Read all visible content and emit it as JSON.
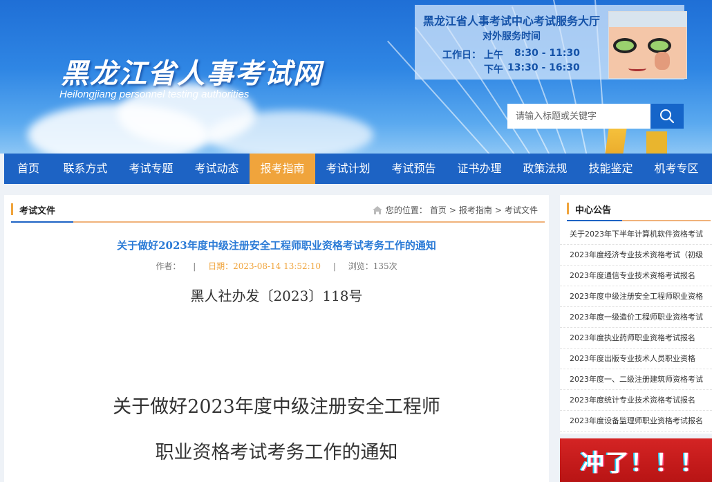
{
  "header": {
    "site_title": "黑龙江省人事考试网",
    "site_subtitle": "Heilongjiang personnel testing authorities",
    "service": {
      "title": "黑龙江省人事考试中心考试服务大厅",
      "subtitle": "对外服务时间",
      "workday_label": "工作日：",
      "morning_label": "上午",
      "morning_time": "8:30 - 11:30",
      "afternoon_label": "下午",
      "afternoon_time": "13:30 - 16:30"
    },
    "search": {
      "placeholder": "请输入标题或关键字",
      "icon": "search-icon"
    }
  },
  "nav": {
    "items": [
      {
        "label": "首页"
      },
      {
        "label": "联系方式"
      },
      {
        "label": "考试专题"
      },
      {
        "label": "考试动态"
      },
      {
        "label": "报考指南",
        "active": true
      },
      {
        "label": "考试计划"
      },
      {
        "label": "考试预告"
      },
      {
        "label": "证书办理"
      },
      {
        "label": "政策法规"
      },
      {
        "label": "技能鉴定"
      },
      {
        "label": "机考专区"
      }
    ]
  },
  "main": {
    "section_title": "考试文件",
    "breadcrumb": {
      "prefix": "您的位置：",
      "home": "首页",
      "sep": ">",
      "guide": "报考指南",
      "current": "考试文件"
    },
    "article": {
      "title": "关于做好2023年度中级注册安全工程师职业资格考试考务工作的通知",
      "author_label": "作者：",
      "sep": "|",
      "date": "日期：2023-08-14 13:52:10",
      "views": "浏览：135次",
      "doc_number": "黑人社办发〔2023〕118号",
      "heading_line1": "关于做好2023年度中级注册安全工程师",
      "heading_line2": "职业资格考试考务工作的通知"
    }
  },
  "sidebar": {
    "title": "中心公告",
    "notices": [
      "关于2023年下半年计算机软件资格考试",
      "2023年度经济专业技术资格考试（初级",
      "2023年度通信专业技术资格考试报名",
      "2023年度中级注册安全工程师职业资格",
      "2023年度一级造价工程师职业资格考试",
      "2023年度执业药师职业资格考试报名",
      "2023年度出版专业技术人员职业资格",
      "2023年度一、二级注册建筑师资格考试",
      "2023年度统计专业技术资格考试报名",
      "2023年度设备监理师职业资格考试报名"
    ],
    "promo_text": "冲了！！！"
  },
  "colors": {
    "nav_bg": "#1d63c4",
    "nav_active": "#f0a43c",
    "article_title": "#2a7ad6",
    "date_color": "#f0a43c"
  }
}
